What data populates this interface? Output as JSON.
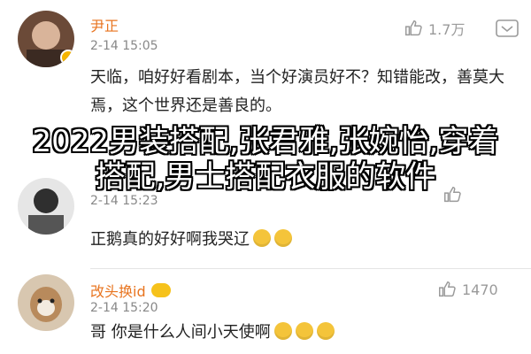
{
  "comments": [
    {
      "username": "尹正",
      "time": "2-14 15:05",
      "likes": "1.7万",
      "text": "天临，咱好好看剧本，当个好演员好不？知错能改，善莫大焉，这个世界还是善良的。"
    },
    {
      "username": "",
      "time": "2-14 15:23",
      "likes": "",
      "text": "正鹅真的好好啊我哭辽"
    },
    {
      "username": "改头换id",
      "time": "2-14 15:20",
      "likes": "1470",
      "text": "哥 你是什么人间小天使啊"
    }
  ],
  "overlay": {
    "title": "2022男装搭配,张君雅,张婉怡,穿着搭配,男士搭配衣服的软件"
  },
  "colors": {
    "username": "#e8741f",
    "time": "#888888",
    "like": "#9a9a9a",
    "text": "#222222"
  }
}
